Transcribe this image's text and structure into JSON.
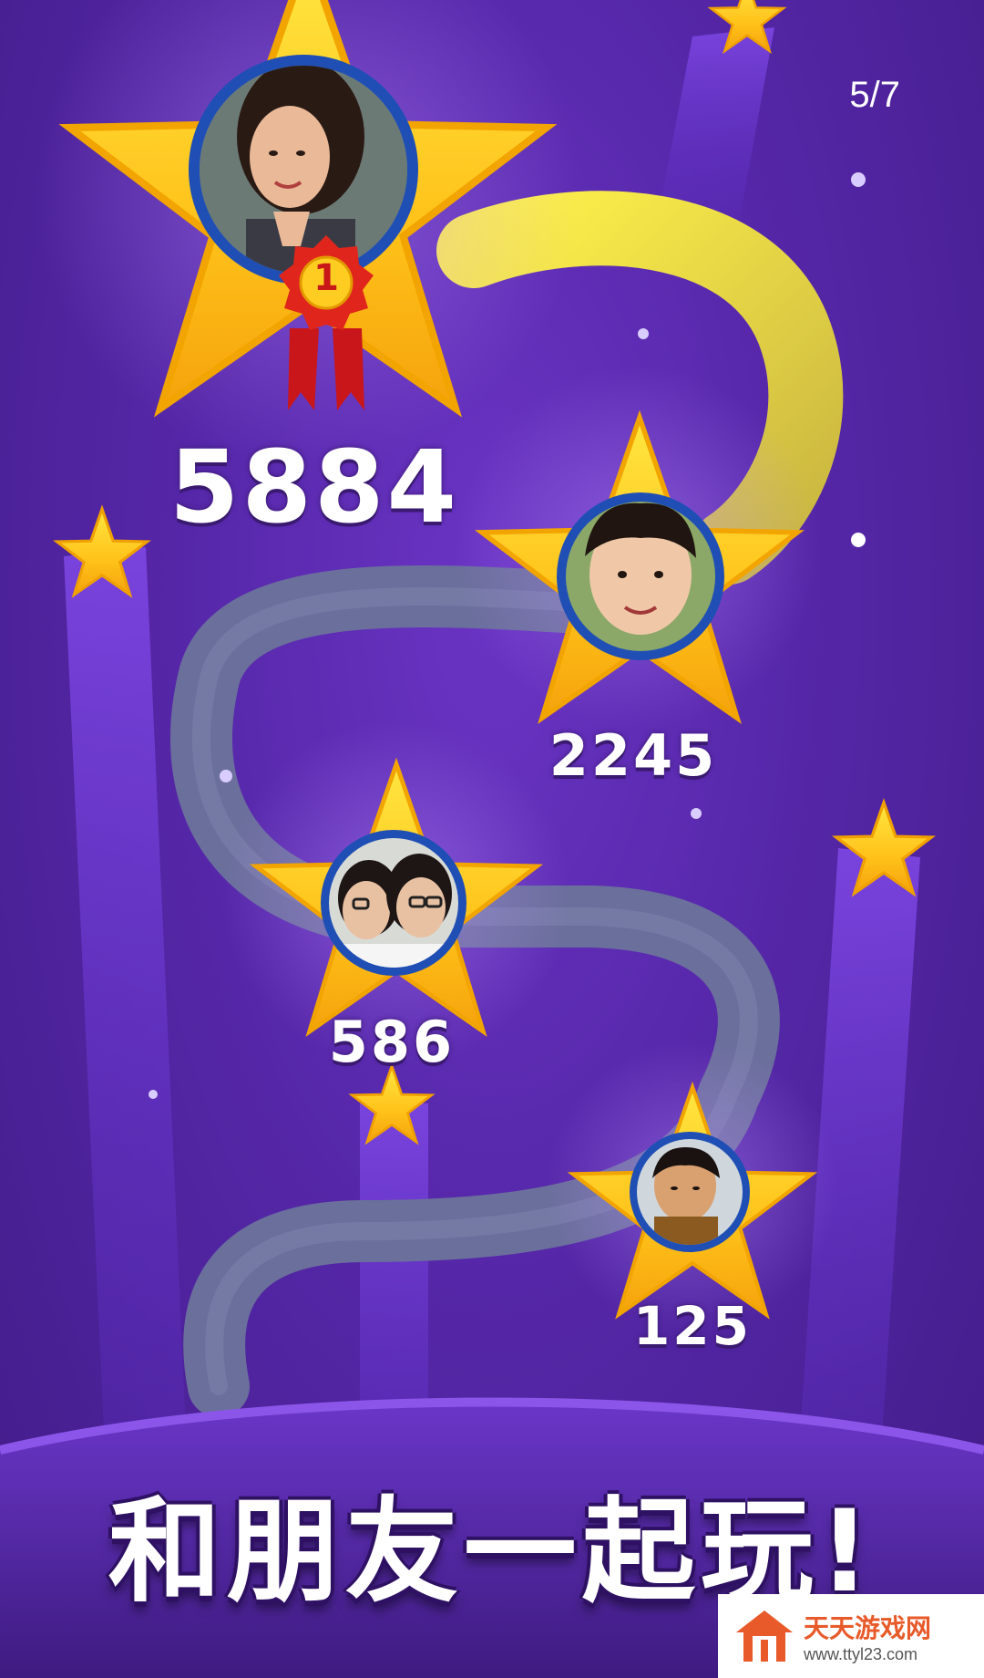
{
  "screen": {
    "counter": "5/7",
    "tagline": "和朋友一起玩!"
  },
  "leaderboard": [
    {
      "rank": "1",
      "score": "5884",
      "avatar": "woman-portrait"
    },
    {
      "score": "2245",
      "avatar": "boy-portrait"
    },
    {
      "score": "586",
      "avatar": "two-girls-portrait"
    },
    {
      "score": "125",
      "avatar": "toddler-portrait"
    }
  ],
  "watermark": {
    "title": "天天游戏网",
    "url": "www.ttyl23.com"
  },
  "colors": {
    "background": "#5527a8",
    "star": "#ffc21a",
    "path_gold": "#f3d21c",
    "path_gray": "#6b6f9c",
    "avatar_ring": "#1f4fb5",
    "medal": "#e0261c"
  }
}
